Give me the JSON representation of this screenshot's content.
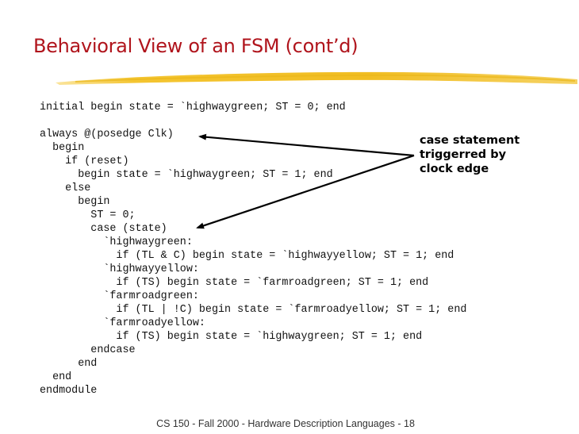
{
  "slide": {
    "title": "Behavioral View of an FSM (cont’d)",
    "title_color": "#b0141c",
    "accent_stroke_color": "#f2c12e",
    "code_lines": [
      "initial begin state = `highwaygreen; ST = 0; end",
      "",
      "always @(posedge Clk)",
      "  begin",
      "    if (reset)",
      "      begin state = `highwaygreen; ST = 1; end",
      "    else",
      "      begin",
      "        ST = 0;",
      "        case (state)",
      "          `highwaygreen:",
      "            if (TL & C) begin state = `highwayyellow; ST = 1; end",
      "          `highwayyellow:",
      "            if (TS) begin state = `farmroadgreen; ST = 1; end",
      "          `farmroadgreen:",
      "            if (TL | !C) begin state = `farmroadyellow; ST = 1; end",
      "          `farmroadyellow:",
      "            if (TS) begin state = `highwaygreen; ST = 1; end",
      "        endcase",
      "      end",
      "  end",
      "endmodule"
    ],
    "annotation": {
      "lines": [
        "case statement",
        "triggerred by",
        "clock edge"
      ],
      "arrows": [
        {
          "points_to": "always @(posedge Clk)"
        },
        {
          "points_to": "case (state)"
        }
      ]
    },
    "footer": "CS 150 - Fall 2000 - Hardware Description Languages - 18"
  }
}
